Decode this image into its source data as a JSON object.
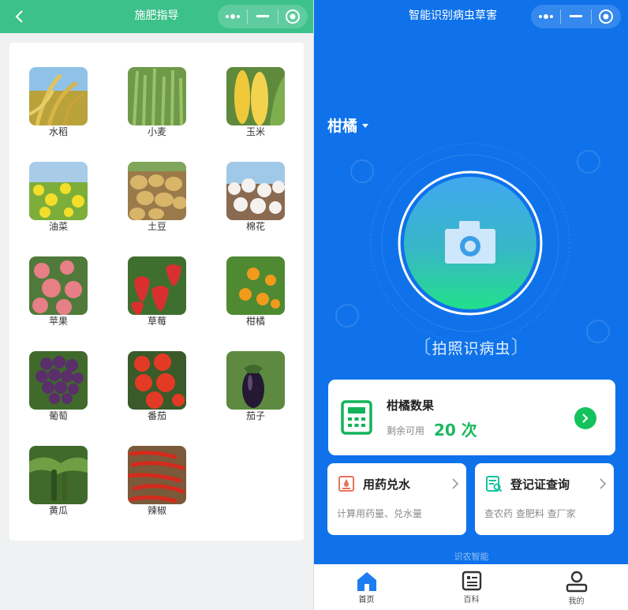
{
  "left_panel": {
    "title": "施肥指导",
    "crops": [
      {
        "name": "水稻",
        "icon": "rice-image"
      },
      {
        "name": "小麦",
        "icon": "wheat-image"
      },
      {
        "name": "玉米",
        "icon": "corn-image"
      },
      {
        "name": "油菜",
        "icon": "rapeseed-image"
      },
      {
        "name": "土豆",
        "icon": "potato-image"
      },
      {
        "name": "棉花",
        "icon": "cotton-image"
      },
      {
        "name": "苹果",
        "icon": "apple-image"
      },
      {
        "name": "草莓",
        "icon": "strawberry-image"
      },
      {
        "name": "柑橘",
        "icon": "citrus-image"
      },
      {
        "name": "葡萄",
        "icon": "grape-image"
      },
      {
        "name": "番茄",
        "icon": "tomato-image"
      },
      {
        "name": "茄子",
        "icon": "eggplant-image"
      },
      {
        "name": "黄瓜",
        "icon": "cucumber-image"
      },
      {
        "name": "辣椒",
        "icon": "chili-image"
      }
    ]
  },
  "right_panel": {
    "title": "智能识别病虫草害",
    "crop_selector": "柑橘",
    "scan_label": "拍照识病虫",
    "count_card": {
      "title": "柑橘数果",
      "subtitle": "剩余可用",
      "count": "20 次"
    },
    "tools": [
      {
        "title": "用药兑水",
        "subtitle": "计算用药量、兑水量"
      },
      {
        "title": "登记证查询",
        "subtitle": "查农药 查肥料 查厂家"
      }
    ],
    "brand": "识农智能",
    "tabs": [
      {
        "label": "首页",
        "icon": "home-icon",
        "active": true
      },
      {
        "label": "百科",
        "icon": "encyclopedia-icon",
        "active": false
      },
      {
        "label": "我的",
        "icon": "profile-icon",
        "active": false
      }
    ]
  },
  "colors": {
    "left_header": "#3cc18a",
    "right_background": "#0f72ea",
    "accent_green": "#1bb85f"
  }
}
